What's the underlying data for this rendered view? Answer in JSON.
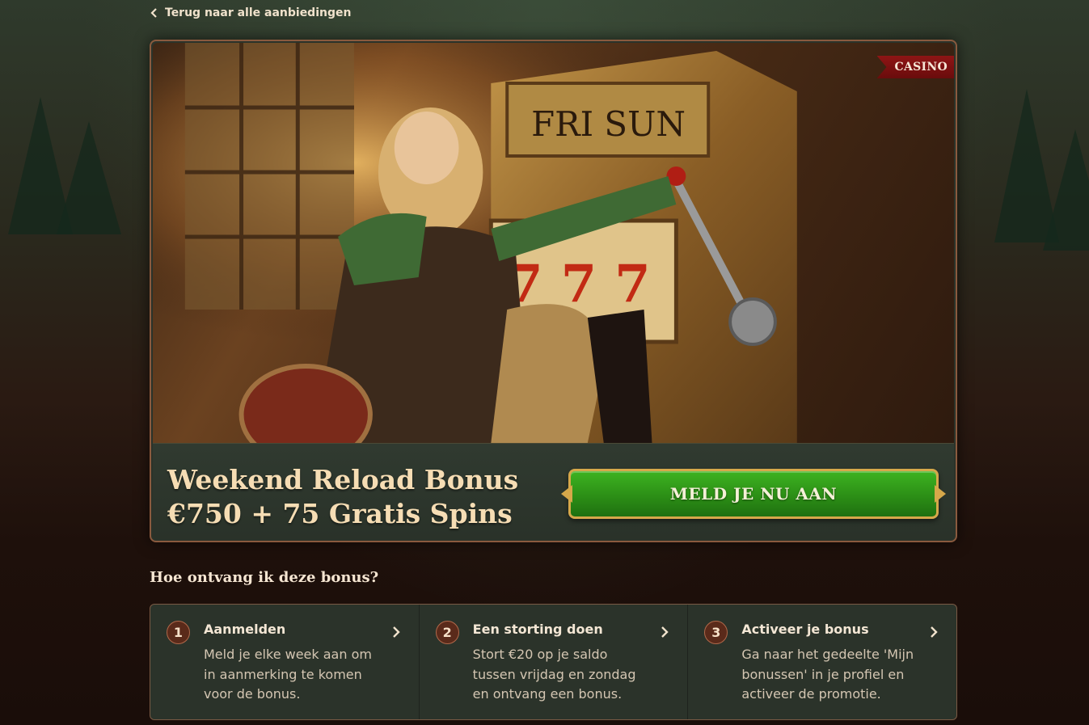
{
  "nav": {
    "back_label": "Terug naar alle aanbiedingen"
  },
  "offer": {
    "category_badge": "CASINO",
    "title_line1": "Weekend Reload Bonus",
    "title_line2": "€750 + 75 Gratis Spins",
    "cta_label": "MELD JE NU AAN",
    "hero_sign_text": "FRI SUN"
  },
  "how_to": {
    "heading": "Hoe ontvang ik deze bonus?",
    "steps": [
      {
        "number": "1",
        "title": "Aanmelden",
        "description": "Meld je elke week aan om in aanmerking te komen voor de bonus."
      },
      {
        "number": "2",
        "title": "Een storting doen",
        "description": "Stort €20 op je saldo tussen vrijdag en zondag en ontvang een bonus."
      },
      {
        "number": "3",
        "title": "Activeer je bonus",
        "description": "Ga naar het gedeelte 'Mijn bonussen' in je profiel en activeer de promotie."
      }
    ]
  },
  "colors": {
    "cta_green": "#2c8f16",
    "cta_border_gold": "#d6a84a",
    "badge_red": "#8e1515",
    "title_cream": "#f6ddb4",
    "panel_green": "#2b332a"
  },
  "icons": {
    "back": "chevron-left-icon",
    "step_arrow": "chevron-right-icon"
  }
}
